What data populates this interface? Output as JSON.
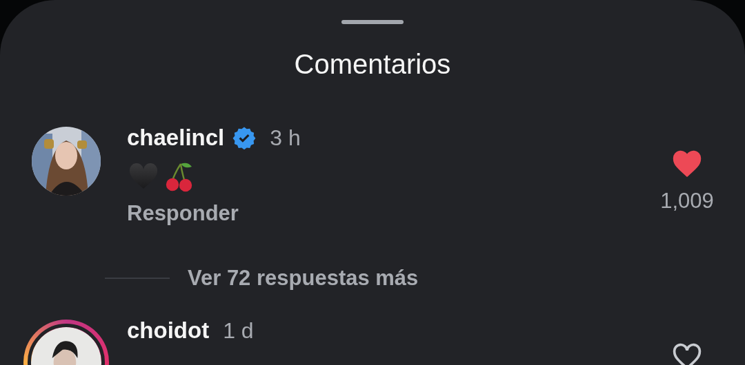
{
  "sheet": {
    "title": "Comentarios"
  },
  "comments": [
    {
      "username": "chaelincl",
      "verified": true,
      "story_ring": false,
      "time": "3 h",
      "reply_label": "Responder",
      "liked": true,
      "likes": "1,009",
      "replies_link": "Ver 72 respuestas más"
    },
    {
      "username": "choidot",
      "verified": false,
      "story_ring": true,
      "time": "1 d",
      "liked": false
    }
  ]
}
